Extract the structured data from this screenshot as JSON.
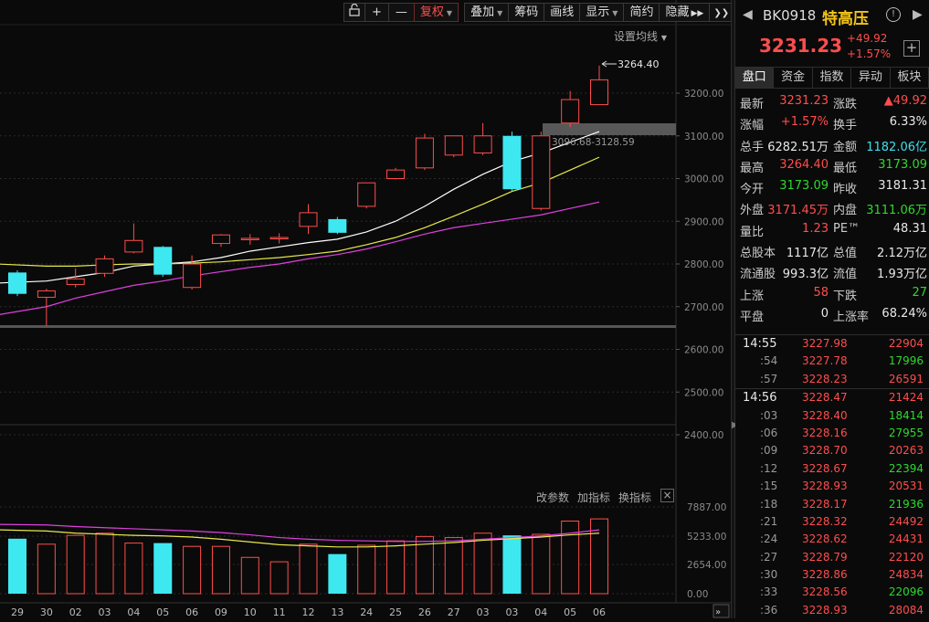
{
  "toolbar": {
    "buttons": [
      {
        "label": "",
        "name": "unlock-icon-button"
      },
      {
        "label": "+",
        "name": "zoom-in-button"
      },
      {
        "label": "—",
        "name": "zoom-out-button"
      },
      {
        "label": "复权",
        "name": "adjust-button",
        "caret": true,
        "active": true
      },
      {
        "label": "叠加",
        "name": "overlay-button",
        "caret": true
      },
      {
        "label": "筹码",
        "name": "chips-button"
      },
      {
        "label": "画线",
        "name": "draw-line-button"
      },
      {
        "label": "显示",
        "name": "display-button",
        "caret": true
      },
      {
        "label": "简约",
        "name": "simple-button"
      },
      {
        "label": "隐藏",
        "name": "hide-button",
        "double_arrow": true
      }
    ],
    "settings_ma": "设置均线"
  },
  "indicator_bar": {
    "change_params": "改参数",
    "add_indicator": "加指标",
    "switch_indicator": "换指标",
    "close": "×"
  },
  "price_axis": [
    "3200.00",
    "3100.00",
    "3000.00",
    "2900.00",
    "2800.00",
    "2700.00",
    "2600.00",
    "2500.00",
    "2400.00"
  ],
  "volume_axis": [
    "7887.00",
    "5233.00",
    "2654.00",
    "0.00"
  ],
  "annotations": {
    "high_marker": "3264.40",
    "range_label": "3096.68-3128.59"
  },
  "x_axis_labels": [
    "29",
    "30",
    "02",
    "03",
    "04",
    "05",
    "06",
    "09",
    "10",
    "11",
    "12",
    "13",
    "24",
    "25",
    "26",
    "27",
    "03",
    "03",
    "04",
    "05",
    "06"
  ],
  "chart_data": {
    "type": "candlestick",
    "categories": [
      "29",
      "30",
      "02",
      "03",
      "04",
      "05",
      "06",
      "09",
      "10",
      "11",
      "12",
      "13",
      "24",
      "25",
      "26",
      "27",
      "03",
      "03",
      "04",
      "05",
      "06"
    ],
    "ohlc": [
      [
        2780,
        2785,
        2725,
        2730
      ],
      [
        2722,
        2742,
        2655,
        2737
      ],
      [
        2752,
        2790,
        2745,
        2765
      ],
      [
        2778,
        2820,
        2770,
        2812
      ],
      [
        2828,
        2895,
        2825,
        2855
      ],
      [
        2840,
        2842,
        2770,
        2775
      ],
      [
        2745,
        2820,
        2740,
        2800
      ],
      [
        2848,
        2870,
        2840,
        2868
      ],
      [
        2860,
        2870,
        2845,
        2860
      ],
      [
        2860,
        2872,
        2848,
        2862
      ],
      [
        2888,
        2940,
        2870,
        2920
      ],
      [
        2905,
        2910,
        2870,
        2873
      ],
      [
        2935,
        2988,
        2930,
        2990
      ],
      [
        3000,
        3025,
        2998,
        3020
      ],
      [
        3025,
        3105,
        3020,
        3095
      ],
      [
        3055,
        3100,
        3050,
        3100
      ],
      [
        3060,
        3130,
        3055,
        3100
      ],
      [
        3100,
        3110,
        2970,
        2975
      ],
      [
        2930,
        3110,
        2925,
        3100
      ],
      [
        3130,
        3205,
        3120,
        3185
      ],
      [
        3173.09,
        3264.4,
        3173.09,
        3231.23
      ]
    ],
    "ma_lines": [
      {
        "color": "#ffffff",
        "values": [
          2755,
          2760,
          2770,
          2780,
          2795,
          2800,
          2805,
          2815,
          2830,
          2840,
          2850,
          2858,
          2875,
          2900,
          2935,
          2975,
          3010,
          3040,
          3060,
          3085,
          3110
        ]
      },
      {
        "color": "#e8e84a",
        "values": [
          2800,
          2795,
          2795,
          2798,
          2800,
          2800,
          2802,
          2805,
          2810,
          2815,
          2822,
          2830,
          2845,
          2862,
          2885,
          2912,
          2940,
          2970,
          2990,
          3020,
          3050
        ]
      },
      {
        "color": "#e040e0",
        "values": [
          2680,
          2700,
          2720,
          2735,
          2750,
          2760,
          2772,
          2782,
          2792,
          2800,
          2812,
          2822,
          2835,
          2852,
          2870,
          2885,
          2895,
          2905,
          2915,
          2930,
          2945
        ]
      }
    ],
    "ylim": [
      2400,
      3280
    ],
    "volume": {
      "values": [
        5000,
        4500,
        5300,
        5500,
        4600,
        4600,
        4300,
        4300,
        3300,
        2900,
        4500,
        3600,
        4400,
        4800,
        5200,
        5100,
        5500,
        5300,
        5400,
        6600,
        6800
      ],
      "ylim": [
        0,
        7887
      ],
      "ma_lines": [
        {
          "color": "#e040e0",
          "values": [
            6300,
            6250,
            6100,
            6000,
            5900,
            5800,
            5700,
            5550,
            5350,
            5100,
            4950,
            4850,
            4800,
            4750,
            4750,
            4800,
            4950,
            5100,
            5250,
            5500,
            5800
          ]
        },
        {
          "color": "#e8e84a",
          "values": [
            5800,
            5700,
            5500,
            5400,
            5300,
            5250,
            5150,
            4950,
            4700,
            4450,
            4350,
            4250,
            4250,
            4350,
            4500,
            4650,
            4850,
            5000,
            5150,
            5350,
            5500
          ]
        }
      ]
    }
  },
  "quote": {
    "code": "BK0918",
    "name": "特高压",
    "price": "3231.23",
    "change": "+49.92",
    "change_pct": "+1.57%"
  },
  "tabs": [
    "盘口",
    "资金",
    "指数",
    "异动",
    "板块"
  ],
  "stats": [
    {
      "l1": "最新",
      "v1": "3231.23",
      "c1": "red",
      "l2": "涨跌",
      "v2": "▲49.92",
      "c2": "red"
    },
    {
      "l1": "涨幅",
      "v1": "+1.57%",
      "c1": "red",
      "l2": "换手",
      "v2": "6.33%",
      "c2": "white"
    },
    {
      "l1": "总手",
      "v1": "6282.51万",
      "c1": "white",
      "l2": "金额",
      "v2": "1182.06亿",
      "c2": "cyan"
    },
    {
      "l1": "最高",
      "v1": "3264.40",
      "c1": "red",
      "l2": "最低",
      "v2": "3173.09",
      "c2": "green"
    },
    {
      "l1": "今开",
      "v1": "3173.09",
      "c1": "green",
      "l2": "昨收",
      "v2": "3181.31",
      "c2": "white"
    },
    {
      "l1": "外盘",
      "v1": "3171.45万",
      "c1": "red",
      "l2": "内盘",
      "v2": "3111.06万",
      "c2": "green"
    },
    {
      "l1": "量比",
      "v1": "1.23",
      "c1": "red",
      "l2": "PE™",
      "v2": "48.31",
      "c2": "white"
    },
    {
      "l1": "总股本",
      "v1": "1117亿",
      "c1": "white",
      "l2": "总值",
      "v2": "2.12万亿",
      "c2": "white"
    },
    {
      "l1": "流通股",
      "v1": "993.3亿",
      "c1": "white",
      "l2": "流值",
      "v2": "1.93万亿",
      "c2": "white"
    },
    {
      "l1": "上涨",
      "v1": "58",
      "c1": "red",
      "l2": "下跌",
      "v2": "27",
      "c2": "green"
    },
    {
      "l1": "平盘",
      "v1": "0",
      "c1": "white",
      "l2": "上涨率",
      "v2": "68.24%",
      "c2": "white"
    }
  ],
  "ticks": [
    {
      "time": "14:55",
      "price": "3227.98",
      "vol": "22904",
      "vc": "red",
      "major": true
    },
    {
      "time": ":54",
      "price": "3227.78",
      "vol": "17996",
      "vc": "green"
    },
    {
      "time": ":57",
      "price": "3228.23",
      "vol": "26591",
      "vc": "red"
    },
    {
      "time": "14:56",
      "price": "3228.47",
      "vol": "21424",
      "vc": "red",
      "major": true,
      "sep": true
    },
    {
      "time": ":03",
      "price": "3228.40",
      "vol": "18414",
      "vc": "green"
    },
    {
      "time": ":06",
      "price": "3228.16",
      "vol": "27955",
      "vc": "green"
    },
    {
      "time": ":09",
      "price": "3228.70",
      "vol": "20263",
      "vc": "red"
    },
    {
      "time": ":12",
      "price": "3228.67",
      "vol": "22394",
      "vc": "green"
    },
    {
      "time": ":15",
      "price": "3228.93",
      "vol": "20531",
      "vc": "red"
    },
    {
      "time": ":18",
      "price": "3228.17",
      "vol": "21936",
      "vc": "green"
    },
    {
      "time": ":21",
      "price": "3228.32",
      "vol": "24492",
      "vc": "red"
    },
    {
      "time": ":24",
      "price": "3228.62",
      "vol": "24431",
      "vc": "red"
    },
    {
      "time": ":27",
      "price": "3228.79",
      "vol": "22120",
      "vc": "red"
    },
    {
      "time": ":30",
      "price": "3228.86",
      "vol": "24834",
      "vc": "red"
    },
    {
      "time": ":33",
      "price": "3228.56",
      "vol": "22096",
      "vc": "green"
    },
    {
      "time": ":36",
      "price": "3228.93",
      "vol": "28084",
      "vc": "red"
    }
  ]
}
